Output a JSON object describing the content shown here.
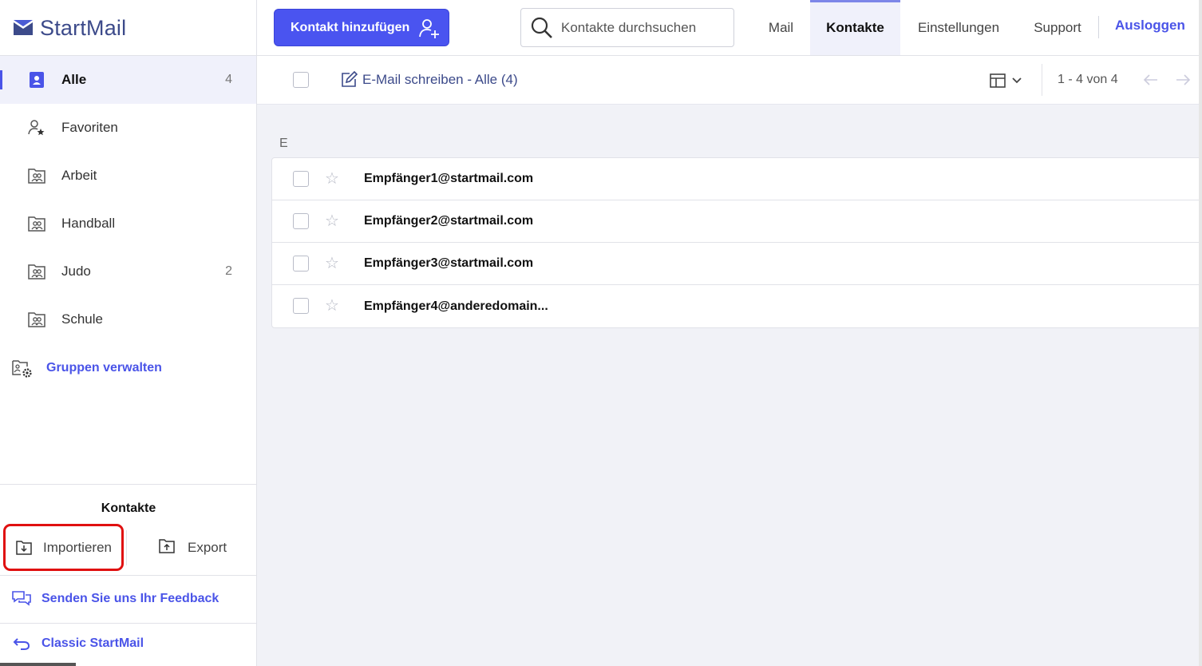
{
  "app": {
    "logo_text": "StartMail"
  },
  "sidebar": {
    "groups": [
      {
        "label": "Alle",
        "count": "4",
        "active": true
      },
      {
        "label": "Favoriten",
        "count": ""
      },
      {
        "label": "Arbeit",
        "count": ""
      },
      {
        "label": "Handball",
        "count": ""
      },
      {
        "label": "Judo",
        "count": "2"
      },
      {
        "label": "Schule",
        "count": ""
      }
    ],
    "manage_groups_label": "Gruppen verwalten",
    "contacts_section_title": "Kontakte",
    "import_label": "Importieren",
    "export_label": "Export",
    "feedback_label": "Senden Sie uns Ihr Feedback",
    "classic_label": "Classic StartMail"
  },
  "header": {
    "add_contact_label": "Kontakt hinzufügen",
    "search_placeholder": "Kontakte durchsuchen",
    "nav_tabs": [
      {
        "label": "Mail"
      },
      {
        "label": "Kontakte",
        "active": true
      },
      {
        "label": "Einstellungen"
      },
      {
        "label": "Support"
      }
    ],
    "logout_label": "Ausloggen"
  },
  "toolbar": {
    "compose_label": "E-Mail schreiben - Alle (4)",
    "pager_text": "1 - 4 von 4"
  },
  "contacts": {
    "section_letter": "E",
    "rows": [
      {
        "email": "Empfänger1@startmail.com"
      },
      {
        "email": "Empfänger2@startmail.com"
      },
      {
        "email": "Empfänger3@startmail.com"
      },
      {
        "email": "Empfänger4@anderedomain..."
      }
    ]
  },
  "colors": {
    "accent": "#4a54f0",
    "highlight_border": "#e01010",
    "active_bg": "#f0f1fb"
  }
}
